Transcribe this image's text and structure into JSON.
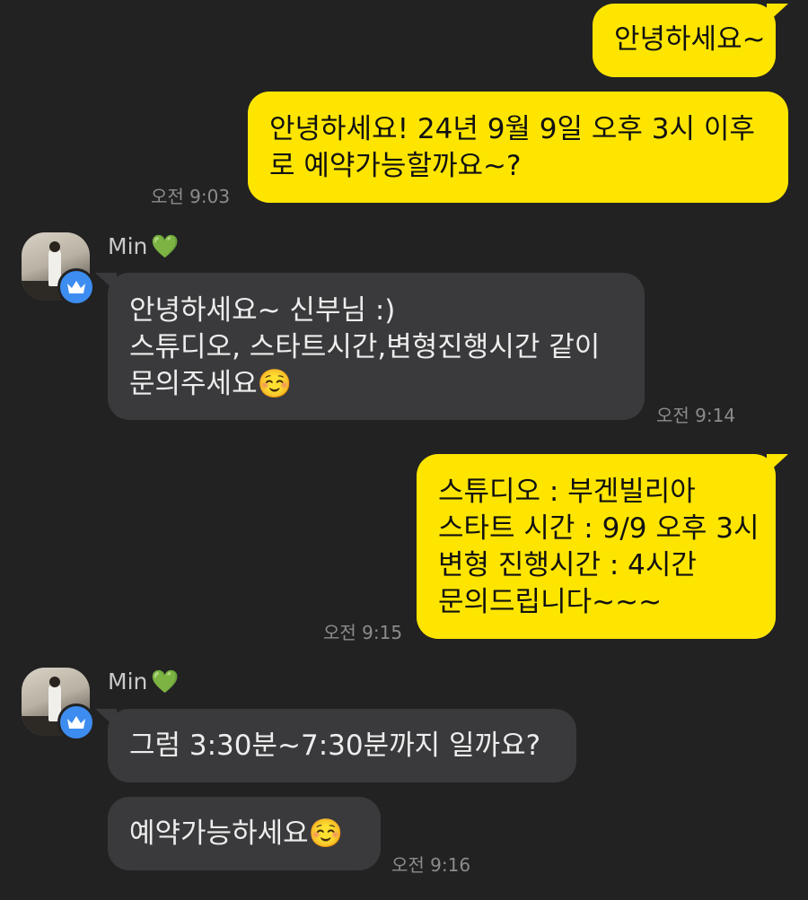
{
  "messages": {
    "m1": {
      "text": "안녕하세요~"
    },
    "m2": {
      "lines": [
        "안녕하세요! 24년 9월 9일 오후 3시 이후",
        "로 예약가능할까요~?"
      ],
      "time": "오전 9:03"
    },
    "m3": {
      "sender": "Min",
      "heart": "💚",
      "lines": [
        "안녕하세요~ 신부님 :)",
        "스튜디오, 스타트시간,변형진행시간 같이",
        "문의주세요☺️"
      ],
      "time": "오전 9:14"
    },
    "m4": {
      "lines": [
        "스튜디오 : 부겐빌리아",
        "스타트 시간 : 9/9 오후 3시",
        "변형 진행시간 : 4시간",
        "문의드립니다~~~"
      ],
      "time": "오전 9:15"
    },
    "m5": {
      "sender": "Min",
      "heart": "💚",
      "text": "그럼 3:30분~7:30분까지 일까요?"
    },
    "m6": {
      "text": "예약가능하세요☺️",
      "time": "오전 9:16"
    }
  },
  "colors": {
    "background": "#222223",
    "my_bubble": "#fee500",
    "their_bubble": "#3a3a3c",
    "badge": "#3d8cf0"
  },
  "icons": {
    "verified_badge": "crown-icon"
  }
}
